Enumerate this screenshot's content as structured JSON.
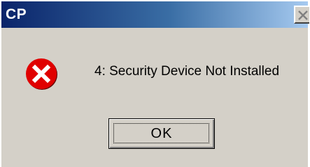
{
  "window": {
    "title": "CP"
  },
  "titlebar": {
    "close_icon": "close-x-icon"
  },
  "dialog": {
    "icon": "error-icon",
    "message": "4: Security Device Not Installed",
    "ok_label": "OK"
  },
  "colors": {
    "titlebar_start": "#0a246a",
    "titlebar_end": "#a6caf0",
    "face": "#d4d0c8",
    "error_red": "#e00000"
  }
}
